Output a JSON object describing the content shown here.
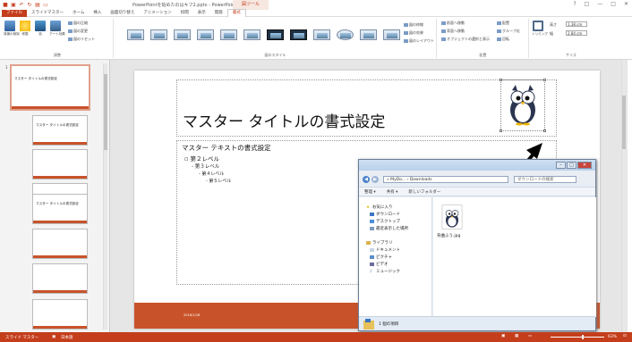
{
  "window": {
    "title": "PowerPointを始めたのはキフ2.pptx - PowerPoint",
    "context_tool": "図ツール",
    "controls": [
      "?",
      "□",
      "—",
      "□",
      "✕"
    ]
  },
  "quick_access": [
    "save",
    "undo",
    "redo",
    "print",
    "start"
  ],
  "tabs": [
    {
      "label": "ファイル",
      "type": "file"
    },
    {
      "label": "スライドマスター"
    },
    {
      "label": "ホーム"
    },
    {
      "label": "挿入"
    },
    {
      "label": "画面切り替え"
    },
    {
      "label": "アニメーション"
    },
    {
      "label": "校閲"
    },
    {
      "label": "表示"
    },
    {
      "label": "開発"
    },
    {
      "label": "書式",
      "active": true
    }
  ],
  "ribbon": {
    "adjust": {
      "label": "調整",
      "buttons": [
        "背景の削除",
        "修整",
        "色",
        "アート効果"
      ],
      "small": [
        "図の圧縮",
        "図の変更",
        "図のリセット"
      ]
    },
    "styles": {
      "label": "図のスタイル",
      "right": [
        "図の枠線",
        "図の効果",
        "図のレイアウト"
      ]
    },
    "arrange": {
      "label": "配置",
      "items": [
        "前面へ移動",
        "背面へ移動",
        "オブジェクトの選択と表示",
        "配置",
        "グループ化",
        "回転"
      ]
    },
    "size": {
      "label": "サイズ",
      "crop": "トリミング",
      "height_label": "高さ",
      "height": "1.38 cm",
      "width_label": "幅",
      "width": "2.84 cm"
    }
  },
  "thumbnails": [
    {
      "num": "1",
      "title": "マスター タイトルの書式設定"
    },
    {
      "num": "",
      "title": "マスター タイトルの書式設定"
    },
    {
      "num": "",
      "title": ""
    },
    {
      "num": "",
      "title": ""
    },
    {
      "num": "",
      "title": "マスター タイトルの書式設定"
    },
    {
      "num": "",
      "title": ""
    },
    {
      "num": "",
      "title": ""
    },
    {
      "num": "",
      "title": ""
    }
  ],
  "slide": {
    "title": "マスター タイトルの書式設定",
    "body": {
      "level1": "マスター テキストの書式設定",
      "level2": "▫ 第２レベル",
      "level3": "- 第３レベル",
      "level4": "- 第４レベル",
      "level5": "- 第５レベル"
    },
    "footer_date": "2016/1/28"
  },
  "explorer": {
    "path": "« MyDo... › Downloads",
    "search_placeholder": "ダウンロードの検索",
    "toolbar": [
      "整理 ▾",
      "共有 ▾",
      "新しいフォルダー"
    ],
    "nav": [
      {
        "label": "お気に入り",
        "icon": "star-icon"
      },
      {
        "label": "ダウンロード",
        "icon": "download-icon"
      },
      {
        "label": "デスクトップ",
        "icon": "desktop-icon"
      },
      {
        "label": "最近表示した場所",
        "icon": "recent-icon"
      },
      {
        "label": "ライブラリ",
        "icon": "library-icon"
      },
      {
        "label": "ドキュメント",
        "icon": "document-icon"
      },
      {
        "label": "ピクチャ",
        "icon": "picture-icon"
      },
      {
        "label": "ビデオ",
        "icon": "video-icon"
      },
      {
        "label": "ミュージック",
        "icon": "music-icon"
      }
    ],
    "file": "背曲ふう.jpg",
    "status": "1 個の項目"
  },
  "statusbar": {
    "mode": "スライド マスター",
    "lang": "日本語",
    "zoom": "63%"
  },
  "colors": {
    "accent": "#c43e1c",
    "footer": "#c8532a"
  }
}
